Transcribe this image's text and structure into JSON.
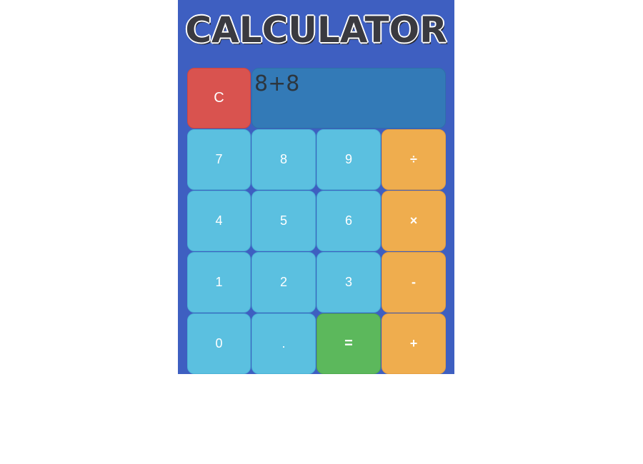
{
  "title": "CALCULATOR",
  "display": {
    "expression": "8+8"
  },
  "buttons": {
    "clear": "C",
    "seven": "7",
    "eight": "8",
    "nine": "9",
    "divide": "÷",
    "four": "4",
    "five": "5",
    "six": "6",
    "multiply": "×",
    "one": "1",
    "two": "2",
    "three": "3",
    "subtract": "-",
    "zero": "0",
    "decimal": ".",
    "equals": "=",
    "add": "+"
  },
  "colors": {
    "background": "#3e5fc1",
    "display": "#337ab7",
    "number_button": "#5bc0e0",
    "operator_button": "#efad4e",
    "equals_button": "#5cb85c",
    "clear_button": "#d9534f"
  }
}
